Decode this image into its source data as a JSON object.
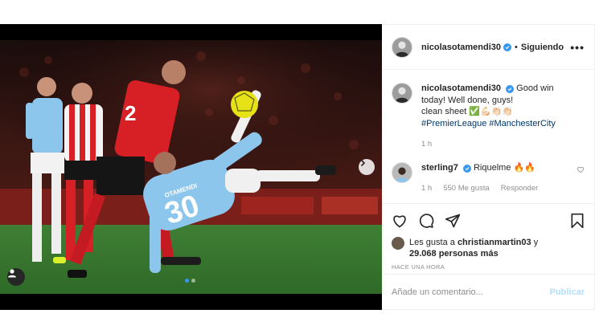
{
  "post": {
    "author": "nicolasotamendi30",
    "separator": "•",
    "follow_label": "Siguiendo",
    "more_icon": "more-horizontal-icon",
    "more_label": "•••"
  },
  "caption": {
    "author": "nicolasotamendi30",
    "line1": "Good win today! Well done, guys!",
    "line2": "clean sheet ✅💪🏻👏🏻👏🏻",
    "hashtags": "#PremierLeague #ManchesterCity",
    "time": "1 h"
  },
  "reply": {
    "author": "sterling7",
    "text": "Riquelme 🔥🔥",
    "time": "1 h",
    "likes": "550 Me gusta",
    "reply_label": "Responder"
  },
  "likes": {
    "prefix": "Les gusta a",
    "user": "christianmartin03",
    "connector": "y",
    "others": "29.068 personas más"
  },
  "timestamp": "HACE UNA HORA",
  "composer": {
    "placeholder": "Añade un comentario...",
    "publish_label": "Publicar"
  },
  "colors": {
    "verified": "#3897f0",
    "hashtag": "#00376b",
    "publish_disabled": "#b2dffc",
    "city_blue": "#8cc6ec",
    "united_red": "#d71f26"
  },
  "media": {
    "slide_count": 2,
    "active_slide": 1,
    "jersey_number_red": "2",
    "jersey_number_blue": "30",
    "jersey_name_blue": "OTAMENDI"
  }
}
